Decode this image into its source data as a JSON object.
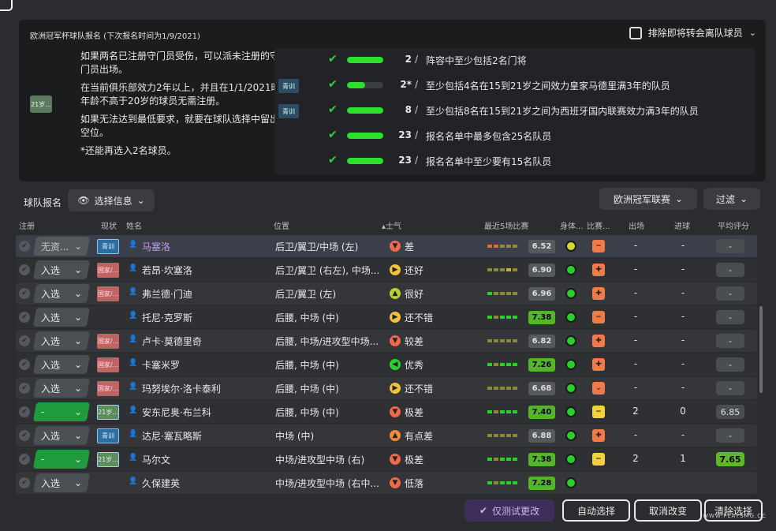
{
  "info_panel": {
    "title": "欧洲冠军杯球队报名 (下次报名时间为1/9/2021)",
    "exclude_label": "排除即将转会离队球员",
    "age_badge": "21岁...",
    "notes": [
      "如果两名已注册守门员受伤，可以派未注册的守门员出场。",
      "在当前俱乐部效力2年以上，并且在1/1/2021时年龄不高于20岁的球员无需注册。",
      "如果无法达到最低要求，就要在球队选择中留出空位。",
      "*还能再选入2名球员。"
    ],
    "rules": [
      {
        "badge": "",
        "progress": 1.0,
        "value": "2",
        "text": "阵容中至少包括2名门将"
      },
      {
        "badge": "青训",
        "progress": 0.5,
        "value": "2*",
        "text": "至少包括4名在15到21岁之间效力皇家马德里满3年的队员"
      },
      {
        "badge": "青训",
        "progress": 1.0,
        "value": "8",
        "text": "至少包括8名在15到21岁之间为西班牙国内联赛效力满3年的队员"
      },
      {
        "badge": "",
        "progress": 1.0,
        "value": "23",
        "text": "报名名单中最多包含25名队员"
      },
      {
        "badge": "",
        "progress": 1.0,
        "value": "23",
        "text": "报名名单中至少要有15名队员"
      }
    ]
  },
  "toolbar": {
    "label": "球队报名",
    "select_info": "选择信息",
    "competition": "欧洲冠军联赛",
    "filter": "过滤"
  },
  "columns": {
    "reg": "注册",
    "status": "现状",
    "name": "姓名",
    "position": "位置",
    "morale": "士气",
    "form": "最近5场比赛",
    "condition": "身体...",
    "match": "比赛...",
    "apps": "出场",
    "goals": "进球",
    "avg": "平均评分"
  },
  "players": [
    {
      "reg": "无资...",
      "reg_style": "grey",
      "status": "青训",
      "status_style": "youth",
      "name": "马塞洛",
      "name_style": "purple",
      "position": "后卫/翼卫/中场 (左)",
      "morale_icon": "▼",
      "morale_color": "#f06a4a",
      "morale": "差",
      "form": [
        "#e06a3a",
        "#e06a3a",
        "#8a8a3a",
        "#8a8a3a",
        "#8a8a3a"
      ],
      "rating": "6.52",
      "rating_style": "grey",
      "cond": "half",
      "pen": "orange",
      "pen_icon": "−",
      "apps": "-",
      "goals": "-",
      "avg": "-",
      "avg_style": ""
    },
    {
      "reg": "入选",
      "reg_style": "",
      "status": "国家/...",
      "status_style": "nat",
      "name": "若昂·坎塞洛",
      "name_style": "",
      "position": "后卫/翼卫 (右左), 中场...",
      "morale_icon": "▶",
      "morale_color": "#f2c23a",
      "morale": "还好",
      "form": [
        "#8a8a3a",
        "#8a8a3a",
        "#8a8a3a",
        "#c8b040",
        "#8a8a3a"
      ],
      "rating": "6.90",
      "rating_style": "grey",
      "cond": "",
      "pen": "orange",
      "pen_icon": "✚",
      "apps": "-",
      "goals": "-",
      "avg": "-",
      "avg_style": ""
    },
    {
      "reg": "入选",
      "reg_style": "",
      "status": "国家/...",
      "status_style": "nat",
      "name": "弗兰德·门迪",
      "name_style": "",
      "position": "后卫/翼卫 (左)",
      "morale_icon": "▲",
      "morale_color": "#b8d030",
      "morale": "很好",
      "form": [
        "#2ad02a",
        "#8a8a3a",
        "#8a8a3a",
        "#8a8a3a",
        "#8a8a3a"
      ],
      "rating": "6.96",
      "rating_style": "grey",
      "cond": "",
      "pen": "orange",
      "pen_icon": "✚",
      "apps": "-",
      "goals": "-",
      "avg": "-",
      "avg_style": ""
    },
    {
      "reg": "入选",
      "reg_style": "",
      "status": "",
      "status_style": "",
      "name": "托尼·克罗斯",
      "name_style": "",
      "position": "后腰, 中场 (中)",
      "morale_icon": "▶",
      "morale_color": "#f2c23a",
      "morale": "还不错",
      "form": [
        "#2ad02a",
        "#8a8a3a",
        "#2ad02a",
        "#2ad02a",
        "#2ad02a"
      ],
      "rating": "7.38",
      "rating_style": "green",
      "cond": "",
      "pen": "orange",
      "pen_icon": "−",
      "apps": "-",
      "goals": "-",
      "avg": "-",
      "avg_style": ""
    },
    {
      "reg": "入选",
      "reg_style": "",
      "status": "国家/...",
      "status_style": "nat",
      "name": "卢卡·莫德里奇",
      "name_style": "",
      "position": "后腰, 中场/进攻型中场...",
      "morale_icon": "▼",
      "morale_color": "#f06a4a",
      "morale": "较差",
      "form": [
        "#8a8a3a",
        "#8a8a3a",
        "#8a8a3a",
        "#8a8a3a",
        "#8a8a3a"
      ],
      "rating": "6.82",
      "rating_style": "grey",
      "cond": "",
      "pen": "orange",
      "pen_icon": "✚",
      "apps": "-",
      "goals": "-",
      "avg": "-",
      "avg_style": ""
    },
    {
      "reg": "入选",
      "reg_style": "",
      "status": "国家/...",
      "status_style": "nat",
      "name": "卡塞米罗",
      "name_style": "",
      "position": "后腰, 中场 (中)",
      "morale_icon": "◀",
      "morale_color": "#2ad02a",
      "morale": "优秀",
      "form": [
        "#2ad02a",
        "#8a8a3a",
        "#2ad02a",
        "#2ad02a",
        "#2ad02a"
      ],
      "rating": "7.26",
      "rating_style": "green",
      "cond": "",
      "pen": "orange",
      "pen_icon": "✚",
      "apps": "-",
      "goals": "-",
      "avg": "-",
      "avg_style": ""
    },
    {
      "reg": "入选",
      "reg_style": "",
      "status": "国家/...",
      "status_style": "nat",
      "name": "玛努埃尔·洛卡泰利",
      "name_style": "",
      "position": "后腰, 中场 (中)",
      "morale_icon": "▶",
      "morale_color": "#f2c23a",
      "morale": "还不错",
      "form": [
        "#8a8a3a",
        "#8a8a3a",
        "#8a8a3a",
        "#8a8a3a",
        "#8a8a3a"
      ],
      "rating": "6.68",
      "rating_style": "grey",
      "cond": "",
      "pen": "orange",
      "pen_icon": "⌄",
      "apps": "-",
      "goals": "-",
      "avg": "-",
      "avg_style": ""
    },
    {
      "reg": "-",
      "reg_style": "green",
      "status": "21岁...",
      "status_style": "u21",
      "name": "安东尼奥·布兰科",
      "name_style": "",
      "position": "后腰, 中场 (中)",
      "morale_icon": "▼",
      "morale_color": "#f06a4a",
      "morale": "极差",
      "form": [
        "#2ad02a",
        "#8a8a3a",
        "#2ad02a",
        "#2ad02a",
        "#2ad02a"
      ],
      "rating": "7.40",
      "rating_style": "green",
      "cond": "",
      "pen": "yellow",
      "pen_icon": "−",
      "apps": "2",
      "goals": "0",
      "avg": "6.85",
      "avg_style": ""
    },
    {
      "reg": "入选",
      "reg_style": "",
      "status": "青训",
      "status_style": "youth",
      "name": "达尼·塞瓦略斯",
      "name_style": "",
      "position": "中场 (中)",
      "morale_icon": "▲",
      "morale_color": "#f08a3a",
      "morale": "有点差",
      "form": [
        "#8a8a3a",
        "#8a8a3a",
        "#8a8a3a",
        "#8a8a3a",
        "#8a8a3a"
      ],
      "rating": "6.88",
      "rating_style": "grey",
      "cond": "",
      "pen": "orange",
      "pen_icon": "✚",
      "apps": "-",
      "goals": "-",
      "avg": "-",
      "avg_style": ""
    },
    {
      "reg": "-",
      "reg_style": "green",
      "status": "21岁...",
      "status_style": "u21",
      "name": "马尔文",
      "name_style": "",
      "position": "中场/进攻型中场 (右)",
      "morale_icon": "▼",
      "morale_color": "#f06a4a",
      "morale": "极差",
      "form": [
        "#2ad02a",
        "#8a8a3a",
        "#2ad02a",
        "#2ad02a",
        "#2ad02a"
      ],
      "rating": "7.38",
      "rating_style": "green",
      "cond": "",
      "pen": "yellow",
      "pen_icon": "−",
      "apps": "2",
      "goals": "1",
      "avg": "7.65",
      "avg_style": "green"
    },
    {
      "reg": "入选",
      "reg_style": "",
      "status": "",
      "status_style": "",
      "name": "久保建英",
      "name_style": "",
      "position": "中场/进攻型中场 (右中...",
      "morale_icon": "▼",
      "morale_color": "#f06a4a",
      "morale": "低落",
      "form": [
        "#2ad02a",
        "#8a8a3a",
        "#2ad02a",
        "#2ad02a",
        "#2ad02a"
      ],
      "rating": "7.28",
      "rating_style": "green",
      "cond": "",
      "pen": "",
      "pen_icon": "",
      "apps": "",
      "goals": "",
      "avg": "",
      "avg_style": ""
    }
  ],
  "bottom": {
    "test_changes": "仅测试更改",
    "auto_select": "自动选择",
    "cancel_changes": "取消改变",
    "clear_selection": "清除选择"
  },
  "watermark": "WWW.PLAYSMG.CC"
}
